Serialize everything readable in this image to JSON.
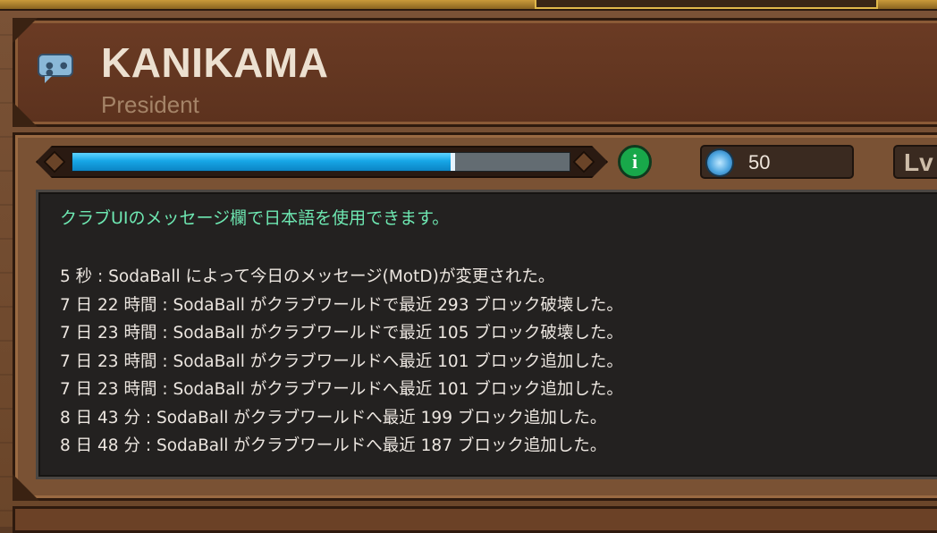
{
  "club": {
    "name": "KANIKAMA",
    "role": "President"
  },
  "status": {
    "xp_progress_fraction": 0.77,
    "gem_count": "50",
    "level_label": "Lv"
  },
  "messages": {
    "motd": "クラブUIのメッセージ欄で日本語を使用できます。",
    "log": [
      "5 秒 : SodaBall によって今日のメッセージ(MotD)が変更された。",
      "7 日 22 時間 : SodaBall がクラブワールドで最近 293 ブロック破壊した。",
      "7 日 23 時間 : SodaBall がクラブワールドで最近 105 ブロック破壊した。",
      "7 日 23 時間 : SodaBall がクラブワールドへ最近 101 ブロック追加した。",
      "7 日 23 時間 : SodaBall がクラブワールドへ最近 101 ブロック追加した。",
      "8 日 43 分 : SodaBall がクラブワールドへ最近 199 ブロック追加した。",
      "8 日 48 分 : SodaBall がクラブワールドへ最近 187 ブロック追加した。"
    ]
  },
  "icons": {
    "chat": "chat-bubble-icon",
    "info": "info-icon",
    "gem": "gem-icon"
  },
  "colors": {
    "xp_fill": "#17a6e6",
    "motd_text": "#6ee8b2",
    "info_badge": "#18a84a"
  }
}
